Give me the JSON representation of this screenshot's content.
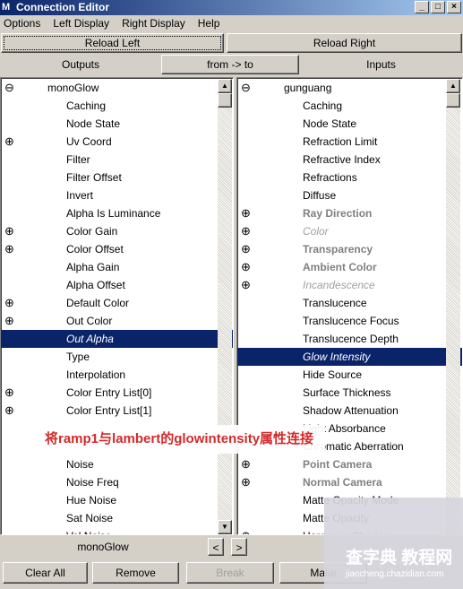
{
  "window": {
    "title": "Connection Editor",
    "icon": "maya-logo-icon"
  },
  "menu": [
    "Options",
    "Left Display",
    "Right Display",
    "Help"
  ],
  "toolbar": {
    "reload_left": "Reload Left",
    "reload_right": "Reload Right",
    "outputs": "Outputs",
    "direction": "from -> to",
    "inputs": "Inputs"
  },
  "left_list": [
    {
      "t": "monoGlow",
      "k": "node"
    },
    {
      "t": "Caching"
    },
    {
      "t": "Node State"
    },
    {
      "t": "Uv Coord",
      "e": 1
    },
    {
      "t": "Filter"
    },
    {
      "t": "Filter Offset"
    },
    {
      "t": "Invert"
    },
    {
      "t": "Alpha Is Luminance"
    },
    {
      "t": "Color Gain",
      "e": 1
    },
    {
      "t": "Color Offset",
      "e": 1
    },
    {
      "t": "Alpha Gain"
    },
    {
      "t": "Alpha Offset"
    },
    {
      "t": "Default Color",
      "e": 1
    },
    {
      "t": "Out Color",
      "e": 1
    },
    {
      "t": "Out Alpha",
      "k": "sel"
    },
    {
      "t": "Type"
    },
    {
      "t": "Interpolation"
    },
    {
      "t": "Color Entry List[0]",
      "e": 1
    },
    {
      "t": "Color Entry List[1]",
      "e": 1
    },
    {
      "t": ""
    },
    {
      "t": ""
    },
    {
      "t": "Noise"
    },
    {
      "t": "Noise Freq"
    },
    {
      "t": "Hue Noise"
    },
    {
      "t": "Sat Noise"
    },
    {
      "t": "Val Noise"
    }
  ],
  "right_list": [
    {
      "t": "gunguang",
      "k": "node"
    },
    {
      "t": "Caching"
    },
    {
      "t": "Node State"
    },
    {
      "t": "Refraction Limit"
    },
    {
      "t": "Refractive Index"
    },
    {
      "t": "Refractions"
    },
    {
      "t": "Diffuse"
    },
    {
      "t": "Ray Direction",
      "e": 1,
      "k": "b"
    },
    {
      "t": "Color",
      "e": 1,
      "k": "i"
    },
    {
      "t": "Transparency",
      "e": 1,
      "k": "b"
    },
    {
      "t": "Ambient Color",
      "e": 1,
      "k": "b"
    },
    {
      "t": "Incandescence",
      "e": 1,
      "k": "i"
    },
    {
      "t": "Translucence"
    },
    {
      "t": "Translucence Focus"
    },
    {
      "t": "Translucence Depth"
    },
    {
      "t": "Glow Intensity",
      "k": "sel"
    },
    {
      "t": "Hide Source"
    },
    {
      "t": "Surface Thickness"
    },
    {
      "t": "Shadow Attenuation"
    },
    {
      "t": "Light Absorbance"
    },
    {
      "t": "Chromatic Aberration"
    },
    {
      "t": "Point Camera",
      "e": 1,
      "k": "b"
    },
    {
      "t": "Normal Camera",
      "e": 1,
      "k": "b"
    },
    {
      "t": "Matte Opacity Mode"
    },
    {
      "t": "Matte Opacity"
    },
    {
      "t": "Hardware Shader",
      "e": 1
    }
  ],
  "nav": {
    "current": "monoGlow",
    "prev": "<",
    "next": ">"
  },
  "buttons": {
    "clear_all": "Clear All",
    "remove": "Remove",
    "break": "Break",
    "make": "Make"
  },
  "caption": "将ramp1与lambert的glowintensity属性连接",
  "watermark": {
    "main": "查字典 教程网",
    "sub": "jiaocheng.chazidian.com"
  },
  "colors": {
    "selection": "#0a246a",
    "caption": "#d42a2a"
  }
}
